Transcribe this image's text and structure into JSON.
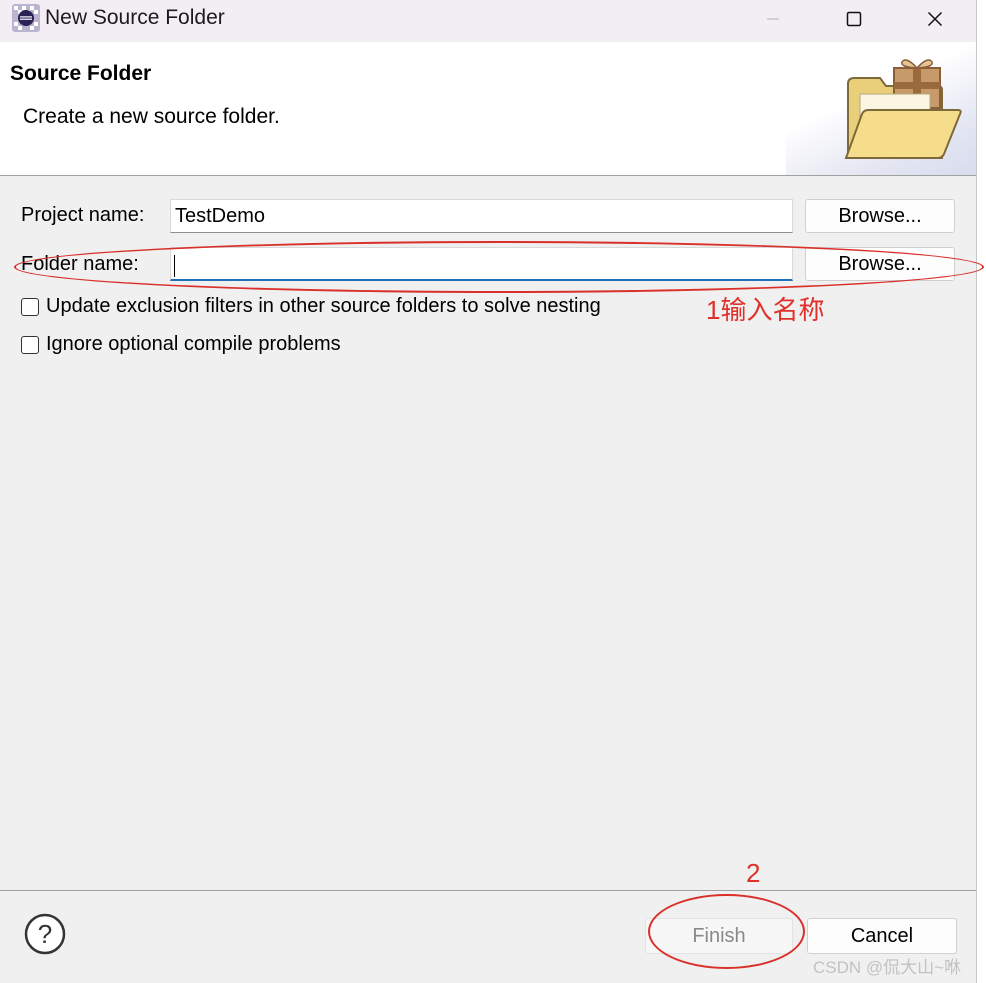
{
  "window": {
    "title": "New Source Folder",
    "icons": {
      "app": "eclipse-icon",
      "minimize": "minimize-icon",
      "maximize": "maximize-icon",
      "close": "close-icon"
    }
  },
  "header": {
    "title": "Source Folder",
    "description": "Create a new source folder.",
    "graphic": "folder-gift-icon"
  },
  "form": {
    "project_name_label": "Project name:",
    "project_name_value": "TestDemo",
    "folder_name_label": "Folder name:",
    "folder_name_value": "",
    "browse_label": "Browse...",
    "update_exclusion_label": "Update exclusion filters in other source folders to solve nesting",
    "update_exclusion_checked": false,
    "ignore_optional_label": "Ignore optional compile problems",
    "ignore_optional_checked": false
  },
  "annotations": {
    "step1": "1输入名称",
    "step2": "2",
    "color": "#e0302a"
  },
  "footer": {
    "help_icon": "help-icon",
    "finish_label": "Finish",
    "finish_enabled": false,
    "cancel_label": "Cancel"
  },
  "watermark": "CSDN @侃大山~咻"
}
